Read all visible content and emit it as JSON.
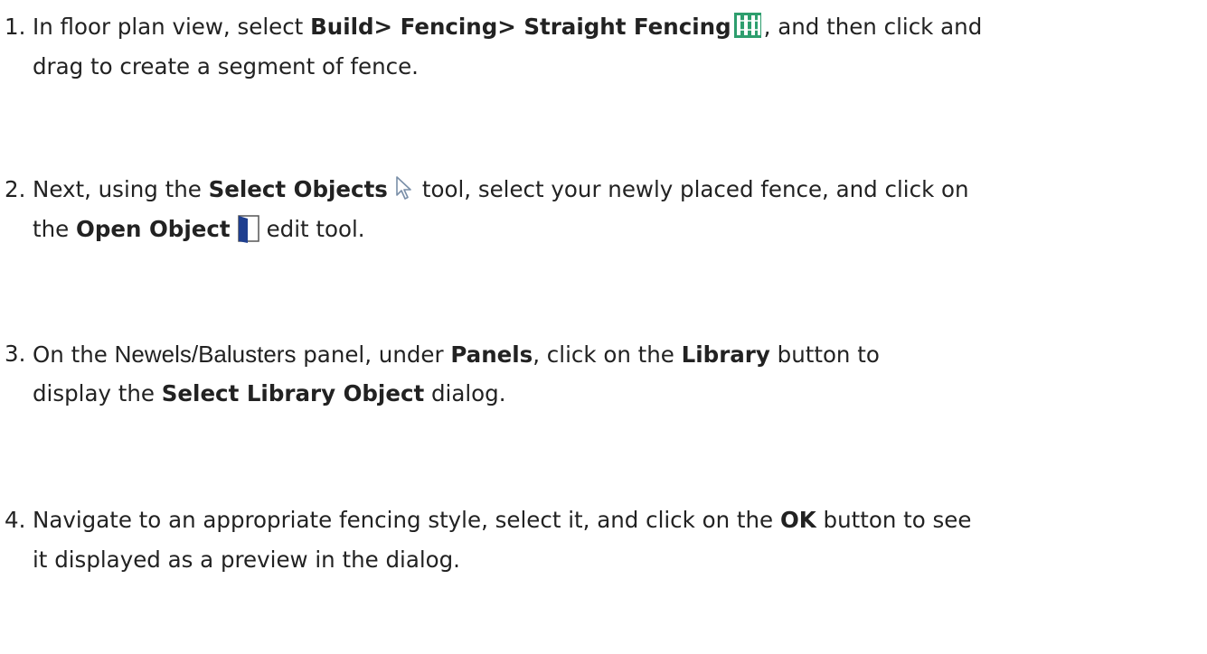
{
  "steps": [
    {
      "number": "1.",
      "line1": {
        "pre": "In floor plan view, select ",
        "bold": "Build> Fencing> Straight Fencing",
        "post": ", and then click and"
      },
      "line2": "drag to create a segment of fence.",
      "icon": "straight-fencing-icon"
    },
    {
      "number": "2.",
      "line1": {
        "pre": "Next, using the ",
        "bold": "Select Objects",
        "post": "tool, select your newly placed fence, and click on"
      },
      "line2": {
        "pre": "the ",
        "bold": "Open Object",
        "post": "edit tool."
      },
      "icons": [
        "select-objects-arrow-icon",
        "open-object-door-icon"
      ]
    },
    {
      "number": "3.",
      "line1": {
        "pre": "On the ",
        "panel": "Newels/Balusters",
        "mid1": " panel, under ",
        "bold1": "Panels",
        "mid2": ", click on the ",
        "bold2": "Library",
        "post": " button to"
      },
      "line2": {
        "pre": "display the ",
        "bold": "Select Library Object",
        "post": " dialog."
      }
    },
    {
      "number": "4.",
      "line1": {
        "pre": "Navigate to an appropriate fencing style, select it, and click on the ",
        "bold": "OK",
        "post": " button to see"
      },
      "line2": "it displayed as a preview in the dialog."
    }
  ],
  "colors": {
    "text": "#222222",
    "fence_icon_green": "#2e9e6e",
    "door_icon_blue": "#1f3f8f"
  }
}
